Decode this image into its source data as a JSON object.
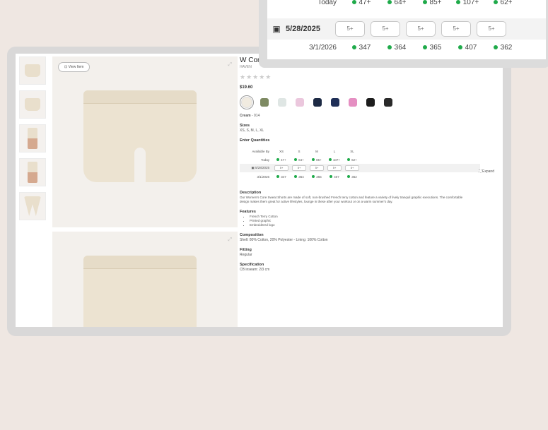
{
  "product": {
    "title": "W Cor",
    "brand": "HAVEN",
    "stars": "★★★★★",
    "price": "$19.60",
    "color_label": "Cream",
    "color_code": "- 014",
    "sizes_label": "Sizes",
    "sizes_value": "XS, S, M, L, XL",
    "quantities_label": "Enter Quantities",
    "expand_label": "Expand",
    "view_label": "View Item",
    "description_label": "Description",
    "description_text": "Our Women's Core Sweat Shorts are made of soft, non-brushed French terry cotton and feature a variety of lively tranquil graphic executions. The comfortable design makes them great for active lifestyles, lounge in these after your workout or on a warm summer's day.",
    "features_label": "Features",
    "features": [
      "French Terry Cotton",
      "Printed graphic",
      "Embroidered logo"
    ],
    "composition_label": "Composition",
    "composition_text": "Shell: 80% Cotton, 20% Polyester - Lining: 100% Cotton",
    "fitting_label": "Fitting",
    "fitting_value": "Regular",
    "specification_label": "Specification",
    "specification_text": "CB inseam: 2/3 cm"
  },
  "swatches": [
    "#f1ebe0",
    "#7e8a63",
    "#dfe6e4",
    "#ebc7dd",
    "#1d2a44",
    "#1f2f57",
    "#e58fc2",
    "#1d1d1d",
    "#2a2a2a"
  ],
  "mini_stock": {
    "header_label": "Available By",
    "sizes": [
      "XS",
      "S",
      "M",
      "L",
      "XL"
    ],
    "today_label": "Today",
    "today": [
      "47+",
      "64+",
      "85+",
      "107+",
      "62+"
    ],
    "date_label": "5/28/2025",
    "date_boxes": [
      "5+",
      "5+",
      "5+",
      "5+",
      "5+"
    ],
    "future_label": "3/1/2026",
    "future": [
      "347",
      "364",
      "365",
      "407",
      "362"
    ]
  },
  "stock_panel": {
    "today_label": "Today",
    "today": [
      "47+",
      "64+",
      "85+",
      "107+",
      "62+"
    ],
    "date_label": "5/28/2025",
    "date_boxes": [
      "5+",
      "5+",
      "5+",
      "5+",
      "5+"
    ],
    "future_label": "3/1/2026",
    "future": [
      "347",
      "364",
      "365",
      "407",
      "362"
    ]
  },
  "colors": {
    "in_stock_dot": "#1faa4a",
    "background": "#efe7e2"
  }
}
